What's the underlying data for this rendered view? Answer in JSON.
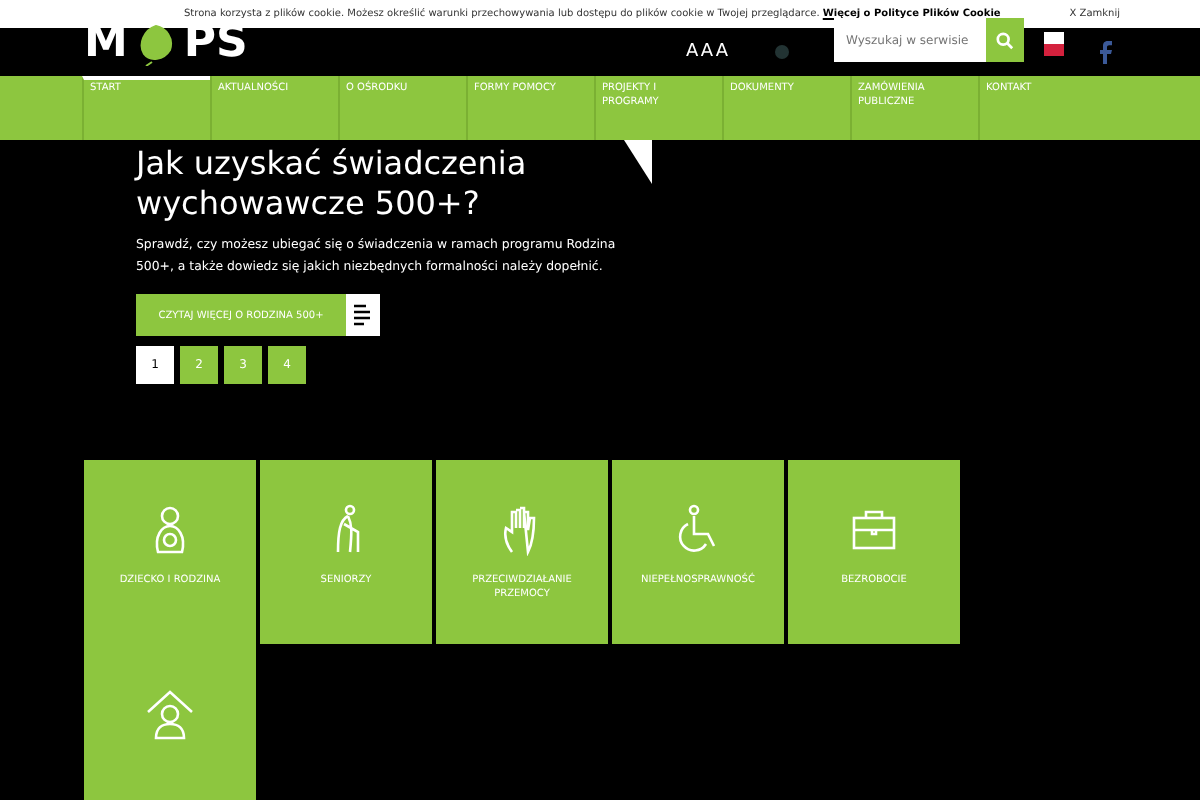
{
  "cookie_bar": {
    "text": "Strona korzysta z plików cookie. Możesz określić warunki przechowywania lub dostępu do plików cookie w Twojej przeglądarce.",
    "link": "Więcej o Polityce Plików Cookie",
    "close": "X Zamknij"
  },
  "header": {
    "logo_left": "M",
    "logo_right": "PS",
    "font_size": "AAA",
    "search": {
      "placeholder": "Wyszukaj w serwisie"
    }
  },
  "nav": [
    {
      "label": "START",
      "selected": true
    },
    {
      "label": "AKTUALNOŚCI",
      "selected": false
    },
    {
      "label": "O OŚRODKU",
      "selected": false
    },
    {
      "label": "FORMY POMOCY",
      "selected": false
    },
    {
      "label": "PROJEKTY I PROGRAMY",
      "selected": false
    },
    {
      "label": "DOKUMENTY",
      "selected": false
    },
    {
      "label": "ZAMÓWIENIA PUBLICZNE",
      "selected": false
    },
    {
      "label": "KONTAKT",
      "selected": false
    }
  ],
  "slide": {
    "title": "Jak uzyskać świadczenia wychowawcze 500+?",
    "text": "Sprawdź, czy możesz ubiegać się o świadczenia w ramach programu Rodzina 500+, a także dowiedz się jakich niezbędnych formalności należy dopełnić.",
    "button": "CZYTAJ WIĘCEJ O RODZINA 500+"
  },
  "pager": [
    {
      "label": "1",
      "selected": true
    },
    {
      "label": "2",
      "selected": false
    },
    {
      "label": "3",
      "selected": false
    },
    {
      "label": "4",
      "selected": false
    }
  ],
  "tiles": [
    {
      "kind": "family",
      "label": "DZIECKO I RODZINA"
    },
    {
      "kind": "senior",
      "label": "SENIORZY"
    },
    {
      "kind": "hand",
      "label": "PRZECIWDZIAŁANIE PRZEMOCY"
    },
    {
      "kind": "wheelchair",
      "label": "NIEPEŁNOSPRAWNOŚĆ"
    },
    {
      "kind": "briefcase",
      "label": "BEZROBOCIE"
    },
    {
      "kind": "home"
    }
  ]
}
